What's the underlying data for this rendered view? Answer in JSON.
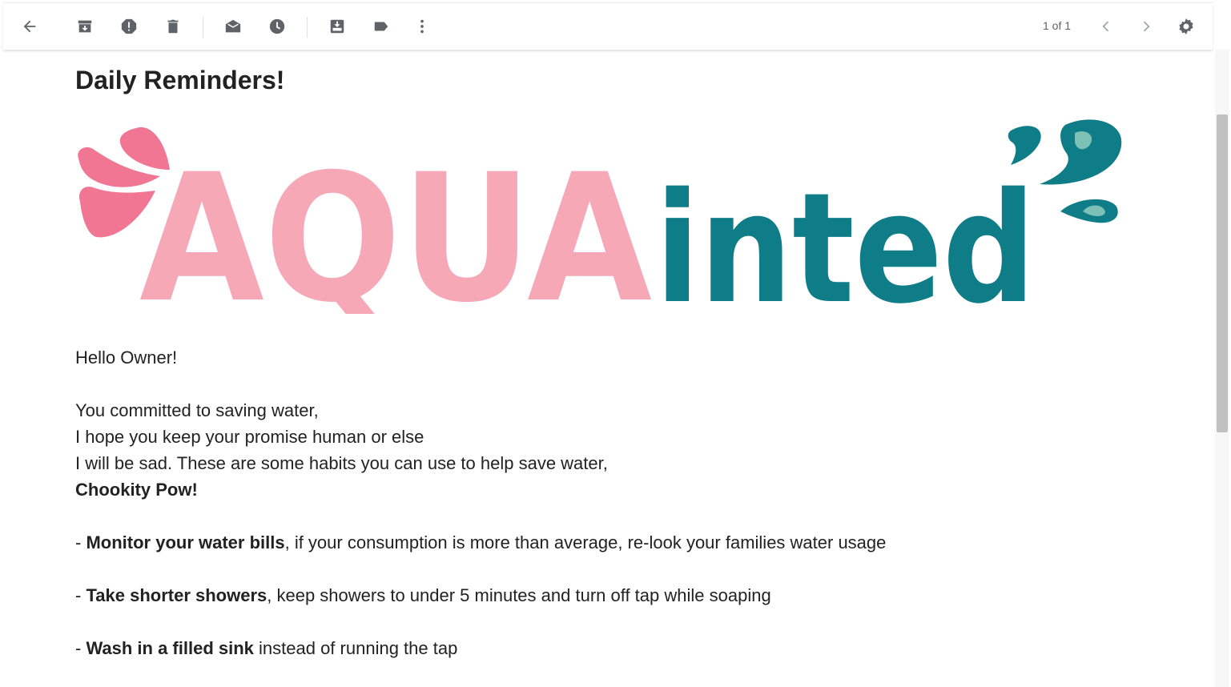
{
  "toolbar": {
    "icons": [
      "back-arrow-icon",
      "archive-icon",
      "report-spam-icon",
      "delete-icon",
      "mark-unread-icon",
      "snooze-icon",
      "move-to-icon",
      "label-icon",
      "more-icon",
      "prev-icon",
      "next-icon",
      "settings-icon"
    ],
    "pager_text": "1 of 1"
  },
  "email": {
    "subject": "Daily Reminders!",
    "logo": {
      "part1": "AQUA",
      "part2": "inted",
      "color_pink": "#f6a8b7",
      "color_pink_dark": "#f07693",
      "color_teal": "#0e7d88"
    },
    "greeting": "Hello Owner!",
    "intro_lines": [
      "You committed to saving water,",
      "I hope you keep your promise human or else",
      "I will be sad. These are some habits you can use to help save water,"
    ],
    "signoff": "Chookity Pow!",
    "tips": [
      {
        "prefix": "- ",
        "bold": "Monitor your water bills",
        "rest": ", if your consumption is more than average, re-look your families water usage"
      },
      {
        "prefix": "- ",
        "bold": "Take shorter showers",
        "rest": ", keep showers to under 5 minutes and turn off tap while soaping"
      },
      {
        "prefix": "- ",
        "bold": "Wash in a filled sink",
        "rest": " instead of running the tap"
      }
    ]
  }
}
